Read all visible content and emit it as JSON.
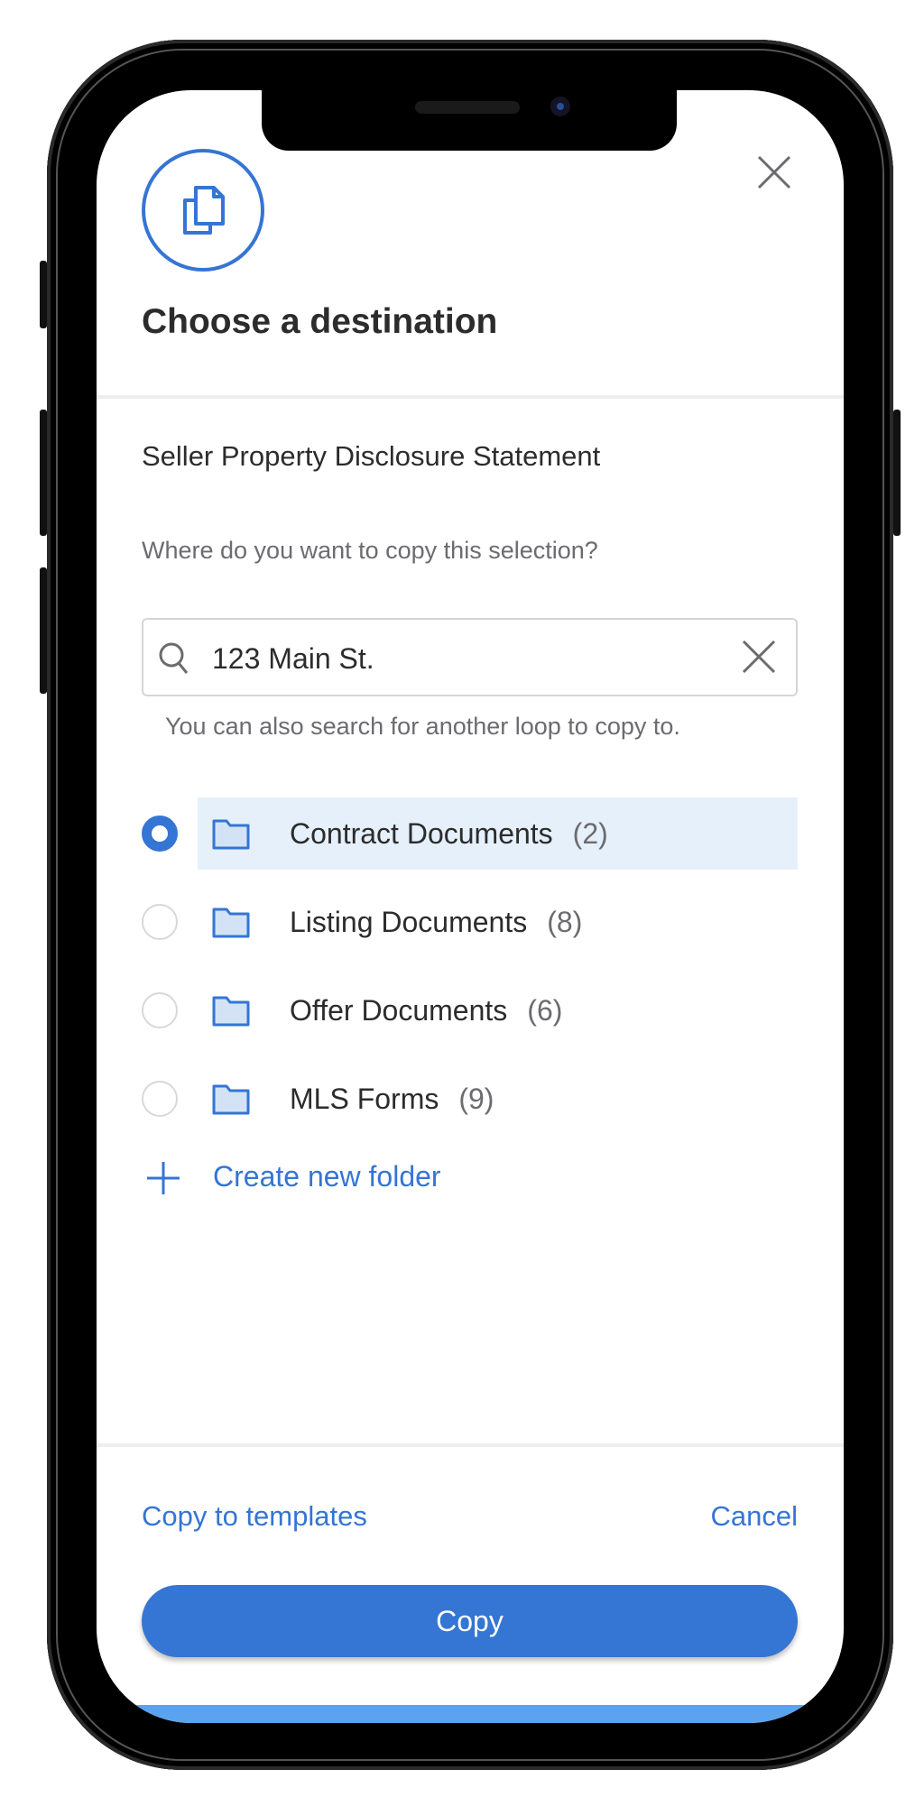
{
  "dialog": {
    "icon": "copy-documents-icon",
    "title": "Choose a destination",
    "close_icon": "close-icon",
    "document_name": "Seller Property Disclosure Statement",
    "question": "Where do you want to copy this selection?"
  },
  "search": {
    "icon": "search-icon",
    "value": "123 Main St.",
    "clear_icon": "clear-icon",
    "hint": "You can also search for another loop to copy to."
  },
  "folders": [
    {
      "name": "Contract Documents",
      "count": "(2)",
      "selected": true
    },
    {
      "name": "Listing Documents",
      "count": "(8)",
      "selected": false
    },
    {
      "name": "Offer Documents",
      "count": "(6)",
      "selected": false
    },
    {
      "name": "MLS Forms",
      "count": "(9)",
      "selected": false
    }
  ],
  "create_folder": {
    "icon": "plus-icon",
    "label": "Create new folder"
  },
  "footer": {
    "copy_to_templates": "Copy to templates",
    "cancel": "Cancel",
    "copy": "Copy"
  },
  "colors": {
    "accent": "#3575d3",
    "selected_row": "#e6f0fa",
    "bottom_strip": "#5ba3ef"
  }
}
